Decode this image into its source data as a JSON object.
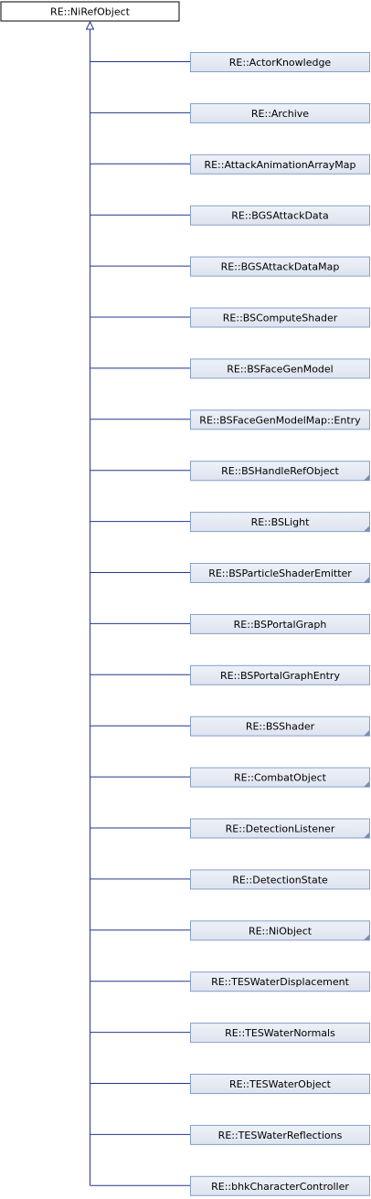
{
  "root": {
    "label": "RE::NiRefObject",
    "fill": "#ffffff"
  },
  "children": [
    {
      "label": "RE::ActorKnowledge",
      "has_more": false
    },
    {
      "label": "RE::Archive",
      "has_more": false
    },
    {
      "label": "RE::AttackAnimationArrayMap",
      "has_more": false
    },
    {
      "label": "RE::BGSAttackData",
      "has_more": false
    },
    {
      "label": "RE::BGSAttackDataMap",
      "has_more": false
    },
    {
      "label": "RE::BSComputeShader",
      "has_more": false
    },
    {
      "label": "RE::BSFaceGenModel",
      "has_more": false
    },
    {
      "label": "RE::BSFaceGenModelMap::Entry",
      "has_more": false
    },
    {
      "label": "RE::BSHandleRefObject",
      "has_more": true
    },
    {
      "label": "RE::BSLight",
      "has_more": true
    },
    {
      "label": "RE::BSParticleShaderEmitter",
      "has_more": true
    },
    {
      "label": "RE::BSPortalGraph",
      "has_more": false
    },
    {
      "label": "RE::BSPortalGraphEntry",
      "has_more": false
    },
    {
      "label": "RE::BSShader",
      "has_more": true
    },
    {
      "label": "RE::CombatObject",
      "has_more": true
    },
    {
      "label": "RE::DetectionListener",
      "has_more": true
    },
    {
      "label": "RE::DetectionState",
      "has_more": false
    },
    {
      "label": "RE::NiObject",
      "has_more": true
    },
    {
      "label": "RE::TESWaterDisplacement",
      "has_more": false
    },
    {
      "label": "RE::TESWaterNormals",
      "has_more": false
    },
    {
      "label": "RE::TESWaterObject",
      "has_more": false
    },
    {
      "label": "RE::TESWaterReflections",
      "has_more": false
    },
    {
      "label": "RE::bhkCharacterController",
      "has_more": false
    }
  ],
  "colors": {
    "child_fill_top": "#eef1f8",
    "child_fill_bottom": "#dde3ef",
    "child_border": "#84a0c8",
    "root_border": "#000000",
    "edge": "#25348a",
    "more_marker": "#7090c0"
  }
}
